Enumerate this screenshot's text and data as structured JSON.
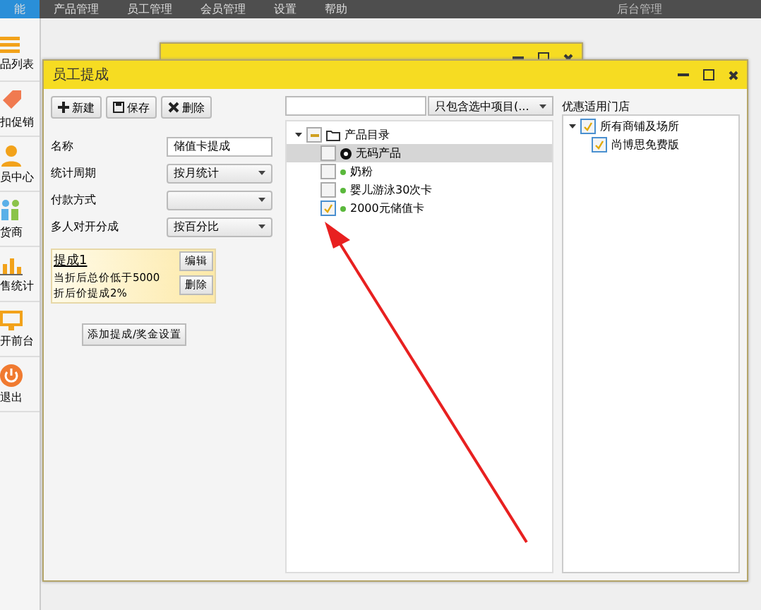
{
  "menu_bar": {
    "items": [
      {
        "label": "能",
        "selected": true
      },
      {
        "label": "产品管理",
        "selected": false
      },
      {
        "label": "员工管理",
        "selected": false
      },
      {
        "label": "会员管理",
        "selected": false
      },
      {
        "label": "设置",
        "selected": false
      },
      {
        "label": "帮助",
        "selected": false
      }
    ],
    "right_label": "后台管理"
  },
  "sidebar": {
    "items": [
      {
        "kind": "list",
        "label": "品列表"
      },
      {
        "kind": "tag",
        "label": "扣促销"
      },
      {
        "kind": "person",
        "label": "员中心"
      },
      {
        "kind": "group",
        "label": "货商"
      },
      {
        "kind": "chart",
        "label": "售统计"
      },
      {
        "kind": "till",
        "label": "开前台"
      },
      {
        "kind": "power",
        "label": "退出"
      }
    ]
  },
  "window": {
    "title": "员工提成",
    "toolbar": [
      {
        "kind": "plus",
        "label": "新建"
      },
      {
        "kind": "save",
        "label": "保存"
      },
      {
        "kind": "delete",
        "label": "删除"
      }
    ],
    "form": [
      {
        "kind": "text",
        "label": "名称",
        "value": "储值卡提成"
      },
      {
        "kind": "select",
        "label": "统计周期",
        "value": "按月统计"
      },
      {
        "kind": "select",
        "label": "付款方式"
      },
      {
        "kind": "select",
        "label": "多人对开分成",
        "value": "按百分比"
      }
    ],
    "rule_card": {
      "title": "提成1",
      "lines": [
        "当折后总价低于5000",
        "折后价提成2%"
      ],
      "buttons": [
        "编辑",
        "删除"
      ]
    },
    "add_button": "添加提成/奖金设置",
    "product_filter": {
      "value": "只包含选中项目(..."
    },
    "product_tree": [
      {
        "label": "产品目录",
        "indeterminate": true,
        "expanded": true,
        "children": [
          {
            "label": "无码产品",
            "kind": "nobarcode",
            "checked": false,
            "selected": true
          },
          {
            "label": "奶粉",
            "kind": "dot",
            "checked": false,
            "selected": false
          },
          {
            "label": "婴儿游泳30次卡",
            "kind": "dot",
            "checked": false,
            "selected": false
          },
          {
            "label": "2000元储值卡",
            "kind": "dot",
            "checked": true,
            "selected": false
          }
        ]
      }
    ],
    "stores": {
      "label": "优惠适用门店",
      "tree": [
        {
          "label": "所有商铺及场所",
          "checked": true,
          "expanded": true,
          "children": [
            {
              "label": "尚博思免费版",
              "checked": true
            }
          ]
        }
      ]
    }
  }
}
